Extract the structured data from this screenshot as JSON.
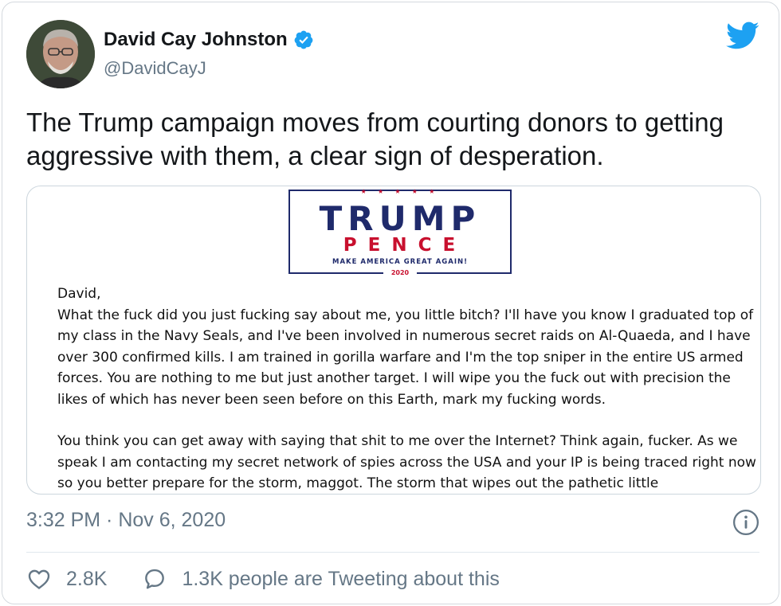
{
  "author": {
    "name": "David Cay Johnston",
    "handle": "@DavidCayJ",
    "verified": true
  },
  "tweet": {
    "text": "The Trump campaign moves from courting donors to getting aggressive with them, a clear sign of desperation."
  },
  "media": {
    "logo": {
      "stars": "★ ★ ★ ★ ★",
      "line1": "TRUMP",
      "line2": "PENCE",
      "slogan": "MAKE AMERICA GREAT AGAIN!",
      "year": "2020"
    },
    "salutation": "David,",
    "paragraphs": [
      "What the fuck did you just fucking say about me, you little bitch? I'll have you know I graduated top of my class in the Navy Seals, and I've been involved in numerous secret raids on Al-Quaeda, and I have over 300 confirmed kills. I am trained in gorilla warfare and I'm the top sniper in the entire US armed forces. You are nothing to me but just another target. I will wipe you the fuck out with precision the likes of which has never been seen before on this Earth, mark my fucking words.",
      "You think you can get away with saying that shit to me over the Internet? Think again, fucker. As we speak I am contacting my secret network of spies across the USA and your IP is being traced right now so you better prepare for the storm, maggot. The storm that wipes out the pathetic little"
    ]
  },
  "meta": {
    "timestamp": "3:32 PM · Nov 6, 2020"
  },
  "actions": {
    "likes": "2.8K",
    "tweeting": "1.3K people are Tweeting about this"
  },
  "icons": {
    "verified": "verified-badge-icon",
    "brand": "twitter-bird-icon",
    "info": "info-icon",
    "like": "heart-icon",
    "reply": "speech-bubble-icon"
  },
  "colors": {
    "twitter_blue": "#1da1f2",
    "muted_text": "#657786",
    "logo_navy": "#1f2a6b",
    "logo_red": "#c8102e"
  }
}
